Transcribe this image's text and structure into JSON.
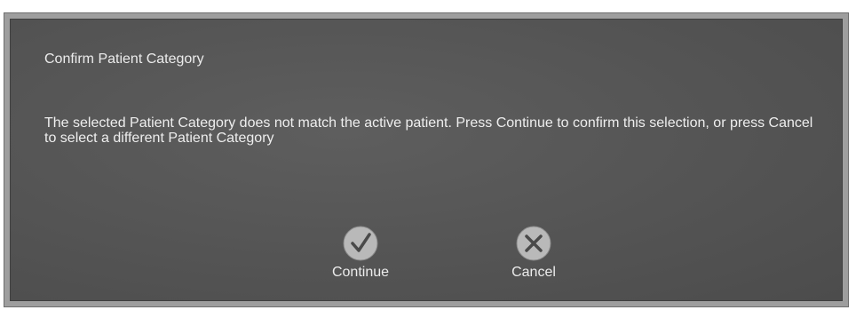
{
  "dialog": {
    "title": "Confirm Patient Category",
    "message": "The selected Patient Category does not match the active patient.  Press Continue to confirm this selection, or press Cancel to select a different Patient Category",
    "actions": {
      "continue_label": "Continue",
      "continue_icon": "check-icon",
      "cancel_label": "Cancel",
      "cancel_icon": "x-icon"
    }
  }
}
